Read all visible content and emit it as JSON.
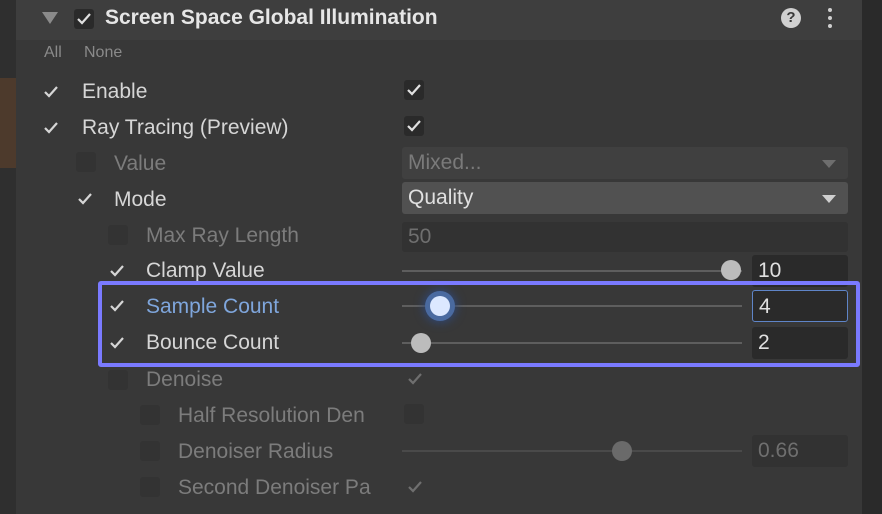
{
  "header": {
    "title": "Screen Space Global Illumination",
    "all_label": "All",
    "none_label": "None",
    "help_glyph": "?",
    "enabled": true
  },
  "rows": {
    "enable": {
      "label": "Enable",
      "overridden": true,
      "value": true
    },
    "ray_tracing": {
      "label": "Ray Tracing (Preview)",
      "overridden": true,
      "value": true
    },
    "value": {
      "label": "Value",
      "overridden": false,
      "selected": "Mixed..."
    },
    "mode": {
      "label": "Mode",
      "overridden": true,
      "selected": "Quality"
    },
    "max_ray_length": {
      "label": "Max Ray Length",
      "overridden": false,
      "value": "50"
    },
    "clamp_value": {
      "label": "Clamp Value",
      "overridden": true,
      "value": "10",
      "slider_fraction": 0.95
    },
    "sample_count": {
      "label": "Sample Count",
      "overridden": true,
      "value": "4",
      "slider_fraction": 0.1
    },
    "bounce_count": {
      "label": "Bounce Count",
      "overridden": true,
      "value": "2",
      "slider_fraction": 0.05
    },
    "denoise": {
      "label": "Denoise",
      "overridden": false,
      "value": true
    },
    "half_resolution": {
      "label": "Half Resolution Den",
      "overridden": false,
      "value": false
    },
    "denoiser_radius": {
      "label": "Denoiser Radius",
      "overridden": false,
      "value": "0.66",
      "slider_fraction": 0.66
    },
    "second_denoiser": {
      "label": "Second Denoiser Pa",
      "overridden": false,
      "value": true
    }
  },
  "colors": {
    "panel_bg": "#383838",
    "highlight_border": "#7a7aff",
    "active_label": "#7fa6dc"
  }
}
